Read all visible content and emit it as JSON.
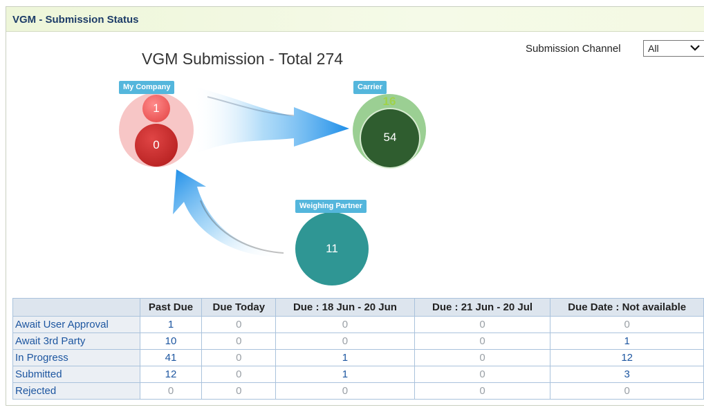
{
  "panel": {
    "title": "VGM - Submission Status"
  },
  "chart": {
    "title": "VGM Submission - Total 274"
  },
  "channel": {
    "label": "Submission Channel",
    "selected": "All"
  },
  "nodes": {
    "my_company": {
      "label": "My Company",
      "top_value": "1",
      "bottom_value": "0"
    },
    "carrier": {
      "label": "Carrier",
      "top_value": "16",
      "main_value": "54"
    },
    "weighing_partner": {
      "label": "Weighing Partner",
      "value": "11"
    }
  },
  "colors": {
    "header_text": "#1d3c68",
    "tag_bg": "#54b6dc",
    "my_company_outer": "#f7c6c6",
    "my_company_top": "#f06666",
    "my_company_bottom": "#c52b2b",
    "carrier_outer": "#9bcf93",
    "carrier_inner": "#2f5d2f",
    "carrier_top": "#8ec63f",
    "weighing_partner": "#2f9694",
    "arrow": "#1e8ee8",
    "link": "#1d56a0"
  },
  "table": {
    "headers": [
      "",
      "Past Due",
      "Due Today",
      "Due : 18 Jun - 20 Jun",
      "Due : 21 Jun - 20 Jul",
      "Due Date : Not available"
    ],
    "rows": [
      {
        "label": "Await User Approval",
        "values": [
          "1",
          "0",
          "0",
          "0",
          "0"
        ]
      },
      {
        "label": "Await 3rd Party",
        "values": [
          "10",
          "0",
          "0",
          "0",
          "1"
        ]
      },
      {
        "label": "In Progress",
        "values": [
          "41",
          "0",
          "1",
          "0",
          "12"
        ]
      },
      {
        "label": "Submitted",
        "values": [
          "12",
          "0",
          "1",
          "0",
          "3"
        ]
      },
      {
        "label": "Rejected",
        "values": [
          "0",
          "0",
          "0",
          "0",
          "0"
        ]
      }
    ]
  }
}
